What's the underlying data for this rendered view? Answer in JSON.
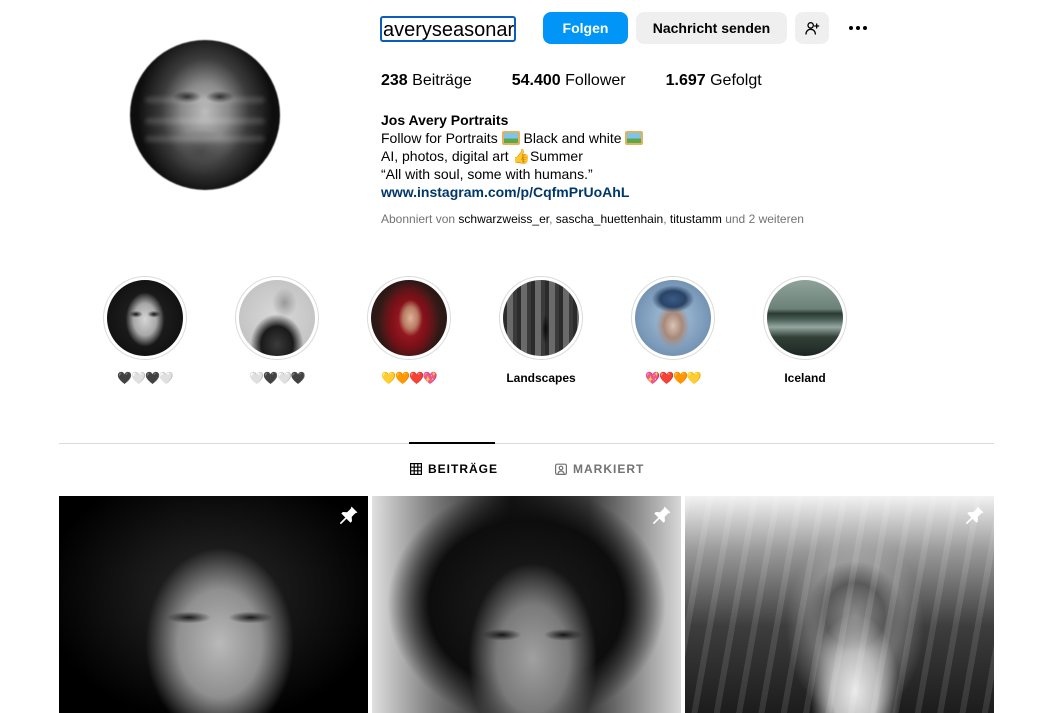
{
  "profile": {
    "username": "averyseasonart",
    "follow_label": "Folgen",
    "message_label": "Nachricht senden",
    "add_user_icon": "person-plus-icon",
    "more_icon": "ellipsis-icon"
  },
  "stats": {
    "posts_count": "238",
    "posts_label": "Beiträge",
    "followers_count": "54.400",
    "followers_label": "Follower",
    "following_count": "1.697",
    "following_label": "Gefolgt"
  },
  "bio": {
    "name": "Jos Avery Portraits",
    "line1_a": "Follow for Portraits ",
    "line1_b": " Black and white ",
    "line2_a": "AI, photos, digital art ",
    "line2_b": "Summer",
    "line3": "“All with soul, some with humans.”",
    "link": "www.instagram.com/p/CqfmPrUoAhL"
  },
  "followed_by": {
    "prefix": "Abonniert von ",
    "user1": "schwarzweiss_er",
    "sep1": ", ",
    "user2": "sascha_huettenhain",
    "sep2": ", ",
    "user3": "titustamm",
    "suffix": " und 2 weiteren"
  },
  "highlights": [
    {
      "label": "🖤🤍🖤🤍"
    },
    {
      "label": "🤍🖤🤍🖤"
    },
    {
      "label": "💛🧡❤️💖"
    },
    {
      "label": "Landscapes"
    },
    {
      "label": "💖❤️🧡💛"
    },
    {
      "label": "Iceland"
    }
  ],
  "tabs": {
    "posts": "BEITRÄGE",
    "tagged": "MARKIERT"
  },
  "posts": [
    {
      "pinned": true
    },
    {
      "pinned": true
    },
    {
      "pinned": true
    }
  ],
  "colors": {
    "follow_button": "#0095f6",
    "secondary_button": "#efefef",
    "link": "#00376b",
    "muted_text": "#737373"
  }
}
